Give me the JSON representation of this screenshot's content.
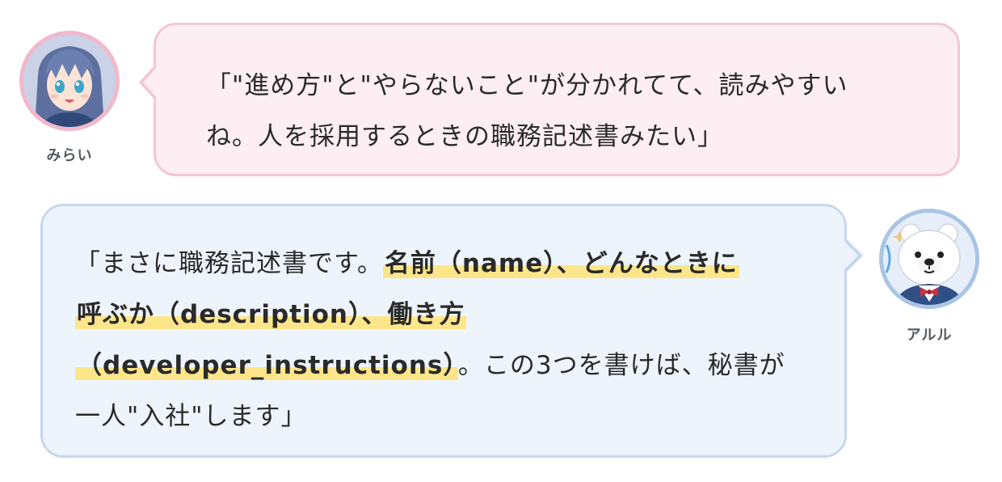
{
  "speakers": {
    "mirai": {
      "name": "みらい",
      "avatar_icon": "anime-girl-avatar-icon",
      "accent": "#f2b8cb"
    },
    "aruru": {
      "name": "アルル",
      "avatar_icon": "polar-bear-avatar-icon",
      "accent": "#a9c4e4"
    }
  },
  "messages": {
    "mirai": {
      "line1": "「\"進め方\"と\"やらないこと\"が分かれてて、読みやすい",
      "line2": "ね。人を採用するときの職務記述書みたい」"
    },
    "aruru": {
      "seg1": "「まさに職務記述書です。",
      "hl1": "名前（name）、どんなときに",
      "hl2": "呼ぶか（description）、働き方",
      "hl3": "（developer_instructions）",
      "seg2": "。この3つを書けば、秘書が",
      "seg3": "一人\"入社\"します」"
    }
  },
  "colors": {
    "mirai_bubble": "#fdeef3",
    "aruru_bubble": "#eef4fc",
    "highlight": "#fde68a"
  }
}
